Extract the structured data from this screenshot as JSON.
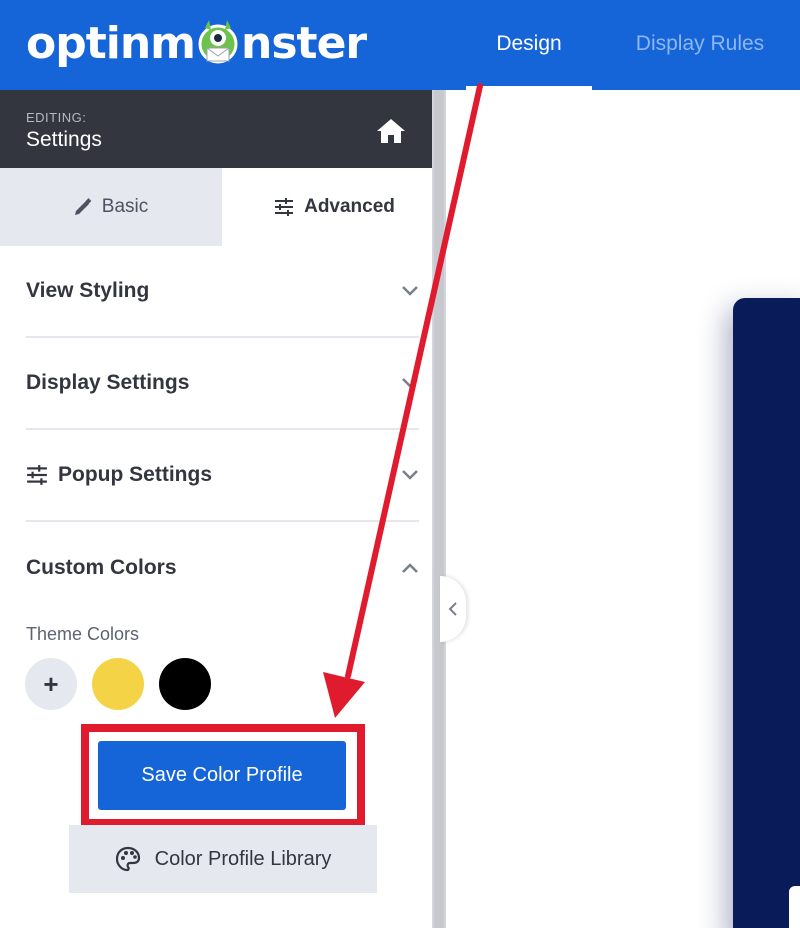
{
  "header": {
    "logo_text_left": "optinm",
    "logo_text_right": "nster",
    "tabs": [
      {
        "label": "Design",
        "active": true
      },
      {
        "label": "Display Rules",
        "active": false
      }
    ],
    "brand_color": "#1565d8"
  },
  "editing": {
    "label": "EDITING:",
    "title": "Settings",
    "home_icon": "home-icon"
  },
  "panel_tabs": {
    "basic_label": "Basic",
    "advanced_label": "Advanced",
    "active": "Advanced"
  },
  "sections": [
    {
      "title": "View Styling",
      "expanded": false
    },
    {
      "title": "Display Settings",
      "expanded": false
    },
    {
      "title": "Popup Settings",
      "expanded": false,
      "icon": "sliders-icon"
    },
    {
      "title": "Custom Colors",
      "expanded": true
    }
  ],
  "custom_colors": {
    "theme_label": "Theme Colors",
    "add_symbol": "+",
    "swatches": [
      "#f4d346",
      "#000000"
    ],
    "save_button": "Save Color Profile",
    "library_button": "Color Profile Library"
  },
  "annotation": {
    "color": "#e11b2e"
  }
}
